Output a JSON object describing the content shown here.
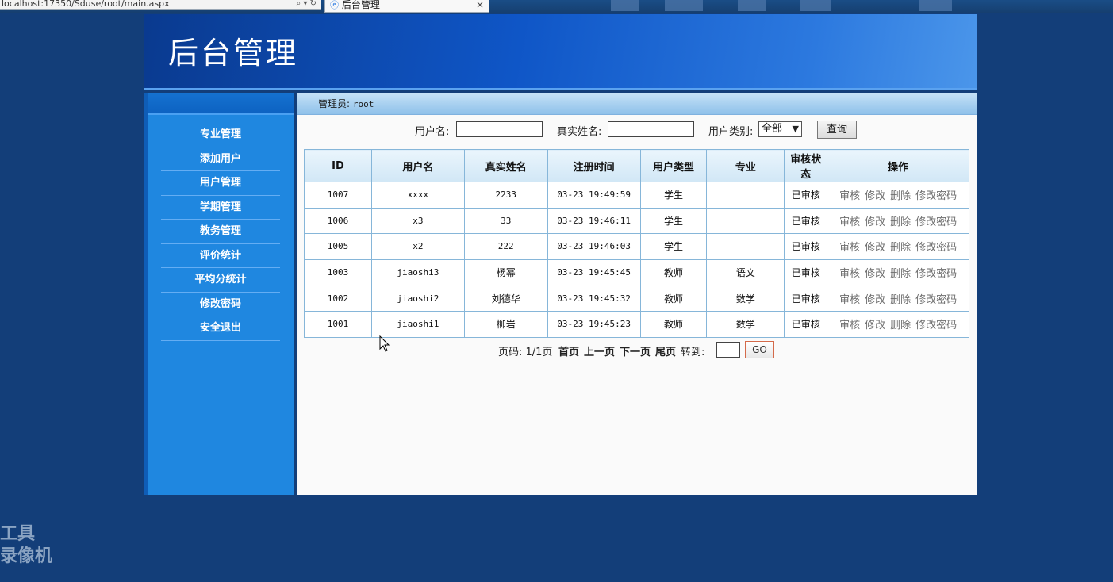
{
  "browser": {
    "address": "localhost:17350/Sduse/root/main.aspx",
    "tab_title": "后台管理",
    "tab_close": "×"
  },
  "header": {
    "title": "后台管理"
  },
  "sidebar": {
    "items": [
      {
        "label": "专业管理"
      },
      {
        "label": "添加用户"
      },
      {
        "label": "用户管理"
      },
      {
        "label": "学期管理"
      },
      {
        "label": "教务管理"
      },
      {
        "label": "评价统计"
      },
      {
        "label": "平均分统计"
      },
      {
        "label": "修改密码"
      },
      {
        "label": "安全退出"
      }
    ]
  },
  "content": {
    "admin_label": "管理员:",
    "admin_value": "root"
  },
  "search": {
    "username_label": "用户名:",
    "username_value": "",
    "realname_label": "真实姓名:",
    "realname_value": "",
    "type_label": "用户类别:",
    "type_selected": "全部",
    "query_button": "查询"
  },
  "table": {
    "headers": [
      "ID",
      "用户名",
      "真实姓名",
      "注册时间",
      "用户类型",
      "专业",
      "审核状态",
      "操作"
    ],
    "rows": [
      {
        "id": "1007",
        "username": "xxxx",
        "realname": "2233",
        "time": "03-23 19:49:59",
        "type": "学生",
        "major": "",
        "status": "已审核"
      },
      {
        "id": "1006",
        "username": "x3",
        "realname": "33",
        "time": "03-23 19:46:11",
        "type": "学生",
        "major": "",
        "status": "已审核"
      },
      {
        "id": "1005",
        "username": "x2",
        "realname": "222",
        "time": "03-23 19:46:03",
        "type": "学生",
        "major": "",
        "status": "已审核"
      },
      {
        "id": "1003",
        "username": "jiaoshi3",
        "realname": "杨幂",
        "time": "03-23 19:45:45",
        "type": "教师",
        "major": "语文",
        "status": "已审核"
      },
      {
        "id": "1002",
        "username": "jiaoshi2",
        "realname": "刘德华",
        "time": "03-23 19:45:32",
        "type": "教师",
        "major": "数学",
        "status": "已审核"
      },
      {
        "id": "1001",
        "username": "jiaoshi1",
        "realname": "柳岩",
        "time": "03-23 19:45:23",
        "type": "教师",
        "major": "数学",
        "status": "已审核"
      }
    ],
    "ops": {
      "audit": "审核",
      "edit": "修改",
      "delete": "删除",
      "change_pwd": "修改密码"
    }
  },
  "pager": {
    "page_info": "页码: 1/1页",
    "first": "首页",
    "prev": "上一页",
    "next": "下一页",
    "last": "尾页",
    "goto_label": "转到:",
    "goto_value": "",
    "go_button": "GO"
  },
  "watermark": {
    "line1": "工具",
    "line2": "录像机"
  },
  "colors": {
    "page_bg": "#133e79",
    "sidebar_bg": "#1f87e0",
    "header_bg": "#0f56c7",
    "table_border": "#86b6d9"
  }
}
